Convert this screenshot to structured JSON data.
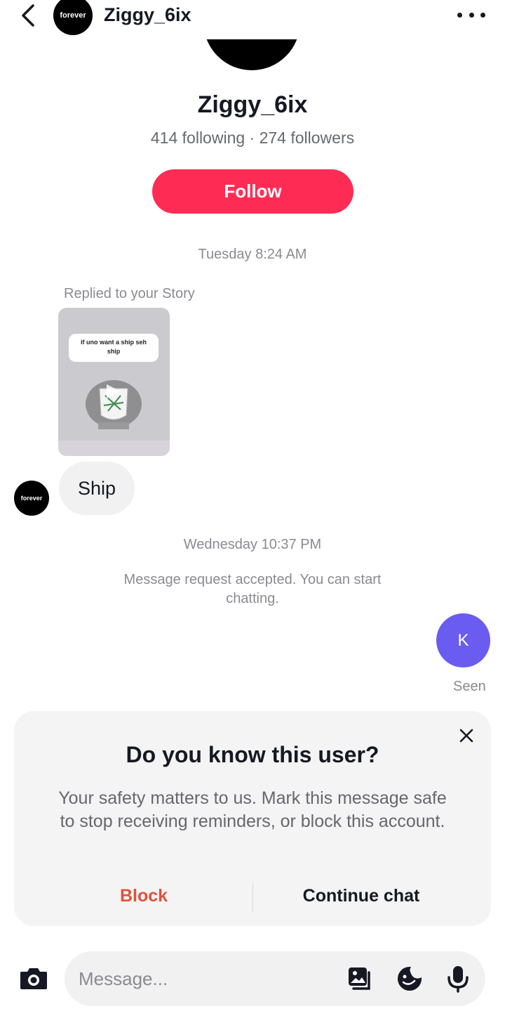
{
  "header": {
    "back_icon": "chevron-left-icon",
    "avatar_text": "forever",
    "username": "Ziggy_6ix",
    "more_icon": "more-horizontal-icon"
  },
  "profile": {
    "name": "Ziggy_6ix",
    "stats": "414 following · 274 followers",
    "follow_label": "Follow",
    "follow_color": "#fe2c55"
  },
  "conversation": {
    "timestamp_1": "Tuesday 8:24 AM",
    "replied_label": "Replied to your Story",
    "story_caption": "if uno want a ship seh ship",
    "sender_avatar_text": "forever",
    "message_1": "Ship",
    "timestamp_2": "Wednesday 10:37 PM",
    "system_message": "Message request accepted. You can start chatting.",
    "my_avatar_letter": "K",
    "my_avatar_color": "#6a5cf0",
    "seen_label": "Seen"
  },
  "safety_card": {
    "title": "Do you know this user?",
    "body": "Your safety matters to us. Mark this message safe to stop receiving reminders, or block this account.",
    "block_label": "Block",
    "block_color": "#e0523a",
    "continue_label": "Continue chat",
    "close_icon": "close-icon"
  },
  "composer": {
    "placeholder": "Message...",
    "camera_icon": "camera-icon",
    "gallery_icon": "gallery-icon",
    "sticker_icon": "sticker-icon",
    "mic_icon": "microphone-icon"
  }
}
